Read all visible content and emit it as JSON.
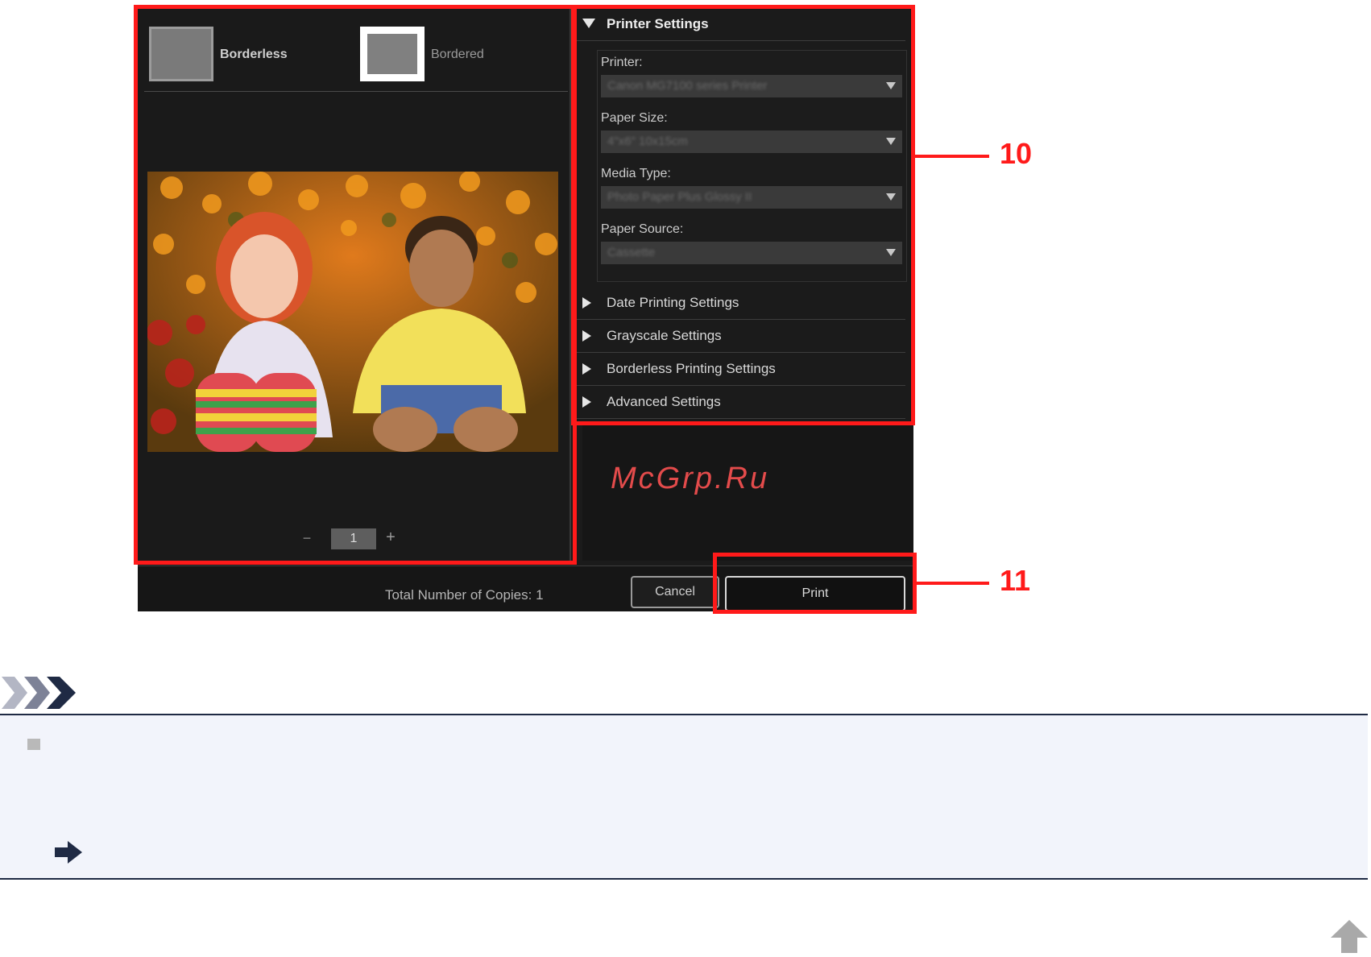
{
  "dialog": {
    "layouts": [
      {
        "label": "Borderless",
        "selected": true
      },
      {
        "label": "Bordered",
        "selected": false
      }
    ],
    "pager": {
      "minus": "−",
      "value": "1",
      "plus": "+"
    },
    "printer_settings": {
      "title": "Printer Settings",
      "fields": [
        {
          "label": "Printer:",
          "value": "Canon MG7100 series Printer"
        },
        {
          "label": "Paper Size:",
          "value": "4\"x6\" 10x15cm"
        },
        {
          "label": "Media Type:",
          "value": "Photo Paper Plus Glossy II"
        },
        {
          "label": "Paper Source:",
          "value": "Cassette"
        }
      ]
    },
    "collapsed_sections": [
      "Date Printing Settings",
      "Grayscale Settings",
      "Borderless Printing Settings",
      "Advanced Settings"
    ],
    "footer": {
      "copies_text": "Total Number of Copies: 1",
      "cancel_label": "Cancel",
      "print_label": "Print"
    }
  },
  "callouts": {
    "settings": "10",
    "print": "11"
  },
  "watermark": "McGrp.Ru",
  "colors": {
    "highlight": "#ff1a1a",
    "dialog_bg": "#1b1b1b",
    "note_bg": "#f2f4fb",
    "note_border": "#1f2a44"
  },
  "icons": [
    "expand-triangle-icon",
    "collapse-triangle-icon",
    "dropdown-arrow-icon",
    "note-chevrons-icon",
    "link-arrow-icon",
    "back-to-top-icon"
  ]
}
